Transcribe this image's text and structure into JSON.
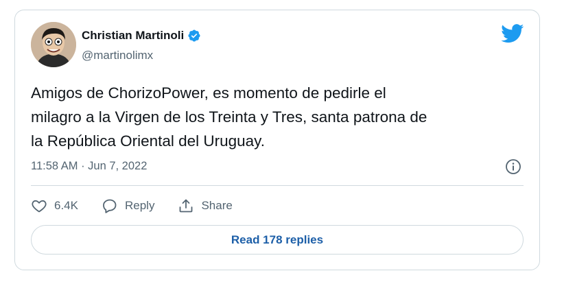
{
  "author": {
    "display_name": "Christian Martinoli",
    "handle": "@martinolimx",
    "verified": true
  },
  "tweet": {
    "text": "Amigos de ChorizoPower, es momento de pedirle el\nmilagro a la Virgen de los Treinta y Tres, santa patrona de\nla República Oriental del Uruguay.",
    "timestamp": "11:58 AM · Jun 7, 2022"
  },
  "actions": {
    "like_count": "6.4K",
    "reply_label": "Reply",
    "share_label": "Share"
  },
  "read_replies_label": "Read 178 replies",
  "icons": {
    "brand": "twitter-bird-icon",
    "verified": "verified-badge-icon",
    "info": "info-icon",
    "like": "heart-icon",
    "reply": "reply-bubble-icon",
    "share": "share-upload-icon"
  },
  "colors": {
    "twitter_blue": "#1d9bf0",
    "verified_blue": "#1d9bf0",
    "text_primary": "#0f1419",
    "text_secondary": "#536471",
    "border": "#cfd9de",
    "link": "#1d5fa8"
  }
}
